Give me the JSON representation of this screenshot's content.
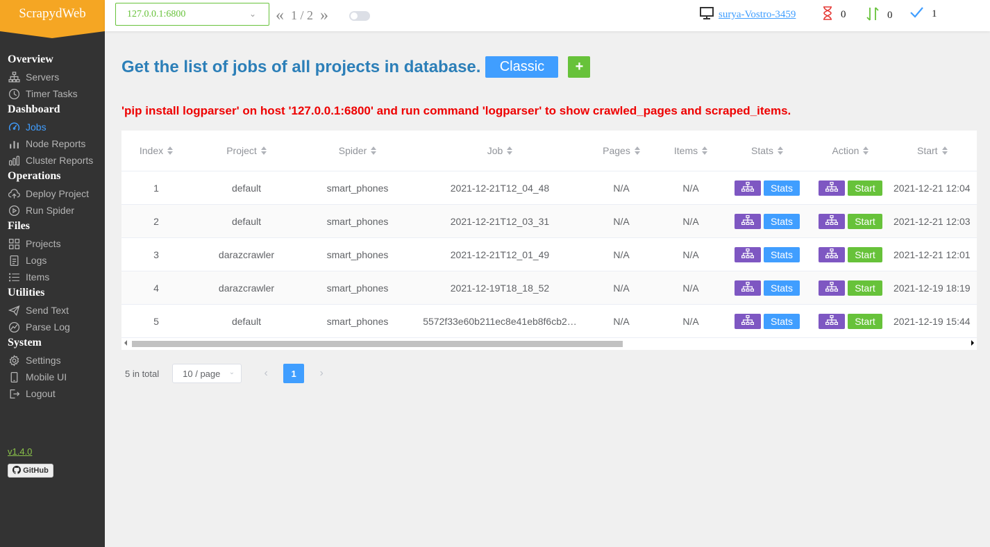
{
  "app": {
    "logo": "ScrapydWeb",
    "version": "v1.4.0",
    "github_label": "GitHub"
  },
  "header": {
    "server": "127.0.0.1:6800",
    "page_indicator": "1 / 2",
    "prev_arrow": "«",
    "next_arrow": "»",
    "hostname": "surya-Vostro-3459",
    "pending_count": "0",
    "running_count": "0",
    "finished_count": "1"
  },
  "sidebar": {
    "sections": [
      {
        "title": "Overview",
        "items": [
          {
            "label": "Servers",
            "icon": "servers-icon"
          },
          {
            "label": "Timer Tasks",
            "icon": "timer-icon"
          }
        ]
      },
      {
        "title": "Dashboard",
        "items": [
          {
            "label": "Jobs",
            "icon": "jobs-icon",
            "active": true
          },
          {
            "label": "Node Reports",
            "icon": "node-reports-icon"
          },
          {
            "label": "Cluster Reports",
            "icon": "cluster-reports-icon"
          }
        ]
      },
      {
        "title": "Operations",
        "items": [
          {
            "label": "Deploy Project",
            "icon": "upload-icon"
          },
          {
            "label": "Run Spider",
            "icon": "play-icon"
          }
        ]
      },
      {
        "title": "Files",
        "items": [
          {
            "label": "Projects",
            "icon": "projects-icon"
          },
          {
            "label": "Logs",
            "icon": "logs-icon"
          },
          {
            "label": "Items",
            "icon": "items-icon"
          }
        ]
      },
      {
        "title": "Utilities",
        "items": [
          {
            "label": "Send Text",
            "icon": "send-icon"
          },
          {
            "label": "Parse Log",
            "icon": "chart-icon"
          }
        ]
      },
      {
        "title": "System",
        "items": [
          {
            "label": "Settings",
            "icon": "gear-icon"
          },
          {
            "label": "Mobile UI",
            "icon": "mobile-icon"
          },
          {
            "label": "Logout",
            "icon": "logout-icon"
          }
        ]
      }
    ]
  },
  "main": {
    "title": "Get the list of jobs of all projects in database.",
    "classic_label": "Classic",
    "plus_label": "+",
    "warning": "'pip install logparser' on host '127.0.0.1:6800' and run command 'logparser' to show crawled_pages and scraped_items."
  },
  "table": {
    "headers": {
      "index": "Index",
      "project": "Project",
      "spider": "Spider",
      "job": "Job",
      "pages": "Pages",
      "items": "Items",
      "stats": "Stats",
      "action": "Action",
      "start": "Start"
    },
    "rows": [
      {
        "index": "1",
        "project": "default",
        "spider": "smart_phones",
        "job": "2021-12-21T12_04_48",
        "pages": "N/A",
        "items": "N/A",
        "stats": "Stats",
        "action": "Start",
        "start": "2021-12-21 12:04"
      },
      {
        "index": "2",
        "project": "default",
        "spider": "smart_phones",
        "job": "2021-12-21T12_03_31",
        "pages": "N/A",
        "items": "N/A",
        "stats": "Stats",
        "action": "Start",
        "start": "2021-12-21 12:03"
      },
      {
        "index": "3",
        "project": "darazcrawler",
        "spider": "smart_phones",
        "job": "2021-12-21T12_01_49",
        "pages": "N/A",
        "items": "N/A",
        "stats": "Stats",
        "action": "Start",
        "start": "2021-12-21 12:01"
      },
      {
        "index": "4",
        "project": "darazcrawler",
        "spider": "smart_phones",
        "job": "2021-12-19T18_18_52",
        "pages": "N/A",
        "items": "N/A",
        "stats": "Stats",
        "action": "Start",
        "start": "2021-12-19 18:19"
      },
      {
        "index": "5",
        "project": "default",
        "spider": "smart_phones",
        "job": "5572f33e60b211ec8e41eb8f6cb2…",
        "pages": "N/A",
        "items": "N/A",
        "stats": "Stats",
        "action": "Start",
        "start": "2021-12-19 15:44"
      }
    ]
  },
  "pagination": {
    "total": "5 in total",
    "page_size": "10 / page",
    "current": "1"
  },
  "colors": {
    "accent": "#409eff",
    "success": "#67c23a",
    "purple": "#7e57c2",
    "logo_bg": "#f5a623",
    "warning": "#ee0000"
  }
}
